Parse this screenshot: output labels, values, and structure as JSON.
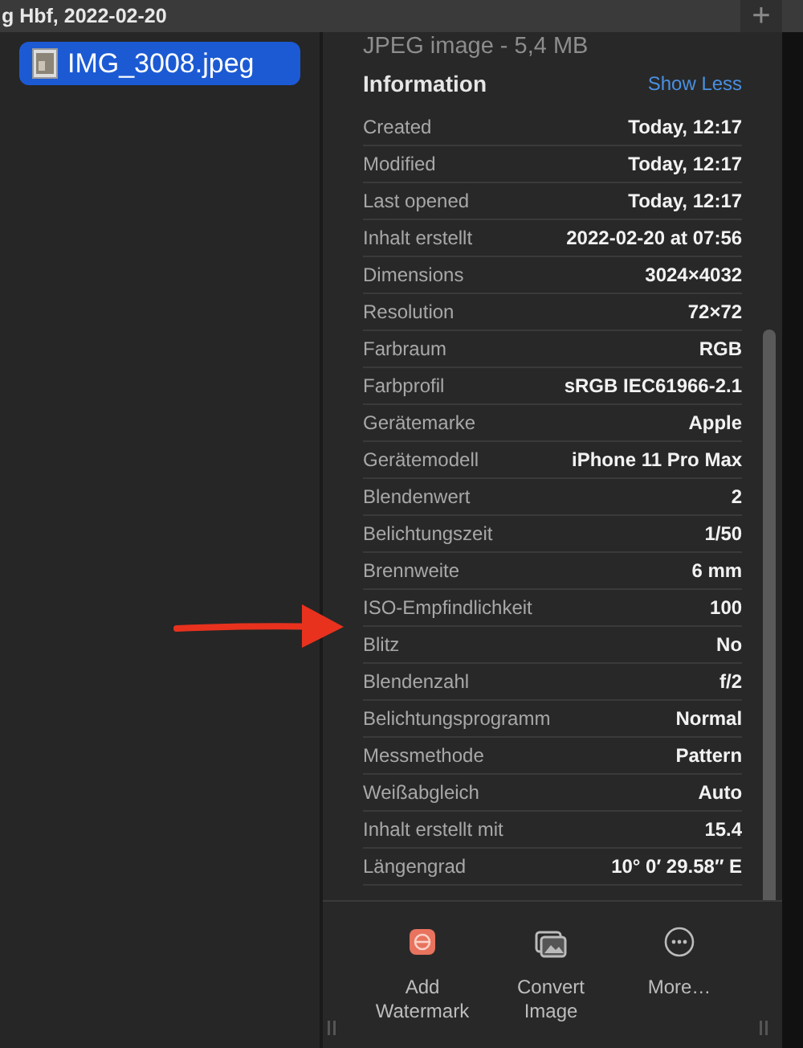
{
  "window": {
    "title": "g Hbf, 2022-02-20",
    "add_button": "+"
  },
  "sidebar": {
    "items": [
      {
        "label": "IMG_3008.jpeg",
        "selected": true
      }
    ]
  },
  "inspector": {
    "subtitle": "JPEG image - 5,4 MB",
    "section_title": "Information",
    "toggle_link": "Show Less",
    "rows": [
      {
        "label": "Created",
        "value": "Today, 12:17"
      },
      {
        "label": "Modified",
        "value": "Today, 12:17"
      },
      {
        "label": "Last opened",
        "value": "Today, 12:17"
      },
      {
        "label": "Inhalt erstellt",
        "value": "2022-02-20 at 07:56"
      },
      {
        "label": "Dimensions",
        "value": "3024×4032"
      },
      {
        "label": "Resolution",
        "value": "72×72"
      },
      {
        "label": "Farbraum",
        "value": "RGB"
      },
      {
        "label": "Farbprofil",
        "value": "sRGB IEC61966-2.1"
      },
      {
        "label": "Gerätemarke",
        "value": "Apple"
      },
      {
        "label": "Gerätemodell",
        "value": "iPhone 11 Pro Max"
      },
      {
        "label": "Blendenwert",
        "value": "2"
      },
      {
        "label": "Belichtungszeit",
        "value": "1/50"
      },
      {
        "label": "Brennweite",
        "value": "6 mm"
      },
      {
        "label": "ISO-Empfindlichkeit",
        "value": "100"
      },
      {
        "label": "Blitz",
        "value": "No"
      },
      {
        "label": "Blendenzahl",
        "value": "f/2"
      },
      {
        "label": "Belichtungsprogramm",
        "value": "Normal"
      },
      {
        "label": "Messmethode",
        "value": "Pattern"
      },
      {
        "label": "Weißabgleich",
        "value": "Auto"
      },
      {
        "label": "Inhalt erstellt mit",
        "value": "15.4"
      },
      {
        "label": "Längengrad",
        "value": "10° 0′ 29.58″ E"
      }
    ],
    "actions": [
      {
        "kind": "watermark",
        "label": "Add Watermark"
      },
      {
        "kind": "convert",
        "label": "Convert Image"
      },
      {
        "kind": "more",
        "label": "More…"
      }
    ]
  }
}
